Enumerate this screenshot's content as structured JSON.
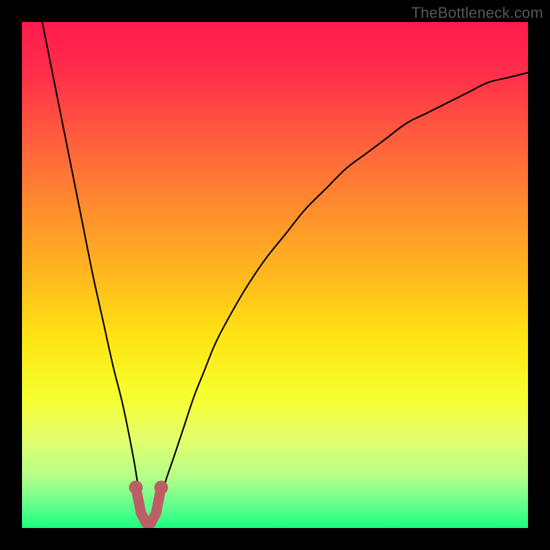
{
  "watermark": "TheBottleneck.com",
  "chart_data": {
    "type": "line",
    "title": "",
    "xlabel": "",
    "ylabel": "",
    "xlim": [
      0,
      100
    ],
    "ylim": [
      0,
      100
    ],
    "grid": false,
    "legend": false,
    "background_gradient": {
      "stops": [
        {
          "pos": 0.0,
          "color": "#ff1a4d"
        },
        {
          "pos": 0.1,
          "color": "#ff2e4a"
        },
        {
          "pos": 0.22,
          "color": "#ff5a3e"
        },
        {
          "pos": 0.36,
          "color": "#ff8a2e"
        },
        {
          "pos": 0.5,
          "color": "#ffb81e"
        },
        {
          "pos": 0.62,
          "color": "#ffe312"
        },
        {
          "pos": 0.74,
          "color": "#f6ff2e"
        },
        {
          "pos": 0.82,
          "color": "#e6ff6a"
        },
        {
          "pos": 0.9,
          "color": "#b3ff8a"
        },
        {
          "pos": 0.96,
          "color": "#5aff8a"
        },
        {
          "pos": 1.0,
          "color": "#1aff80"
        }
      ]
    },
    "series": [
      {
        "name": "curve",
        "color": "#000000",
        "x": [
          4,
          6,
          8,
          10,
          12,
          14,
          16,
          18,
          20,
          22,
          23,
          24,
          25,
          26,
          27,
          28,
          30,
          32,
          34,
          36,
          38,
          40,
          44,
          48,
          52,
          56,
          60,
          64,
          68,
          72,
          76,
          80,
          84,
          88,
          92,
          96,
          100
        ],
        "y": [
          100,
          90,
          80,
          70,
          60,
          50,
          41,
          32,
          24,
          14,
          8,
          3,
          1,
          1,
          3,
          8,
          14,
          20,
          26,
          31,
          36,
          40,
          47,
          53,
          58,
          63,
          67,
          71,
          74,
          77,
          80,
          82,
          84,
          86,
          88,
          89,
          90
        ]
      },
      {
        "name": "marker-segment",
        "color": "#c06068",
        "style": "thick-with-endpoints",
        "x": [
          22.5,
          23.5,
          24.5,
          25.5,
          26.5,
          27.5
        ],
        "y": [
          8,
          3,
          1,
          1,
          3,
          8
        ]
      }
    ]
  }
}
